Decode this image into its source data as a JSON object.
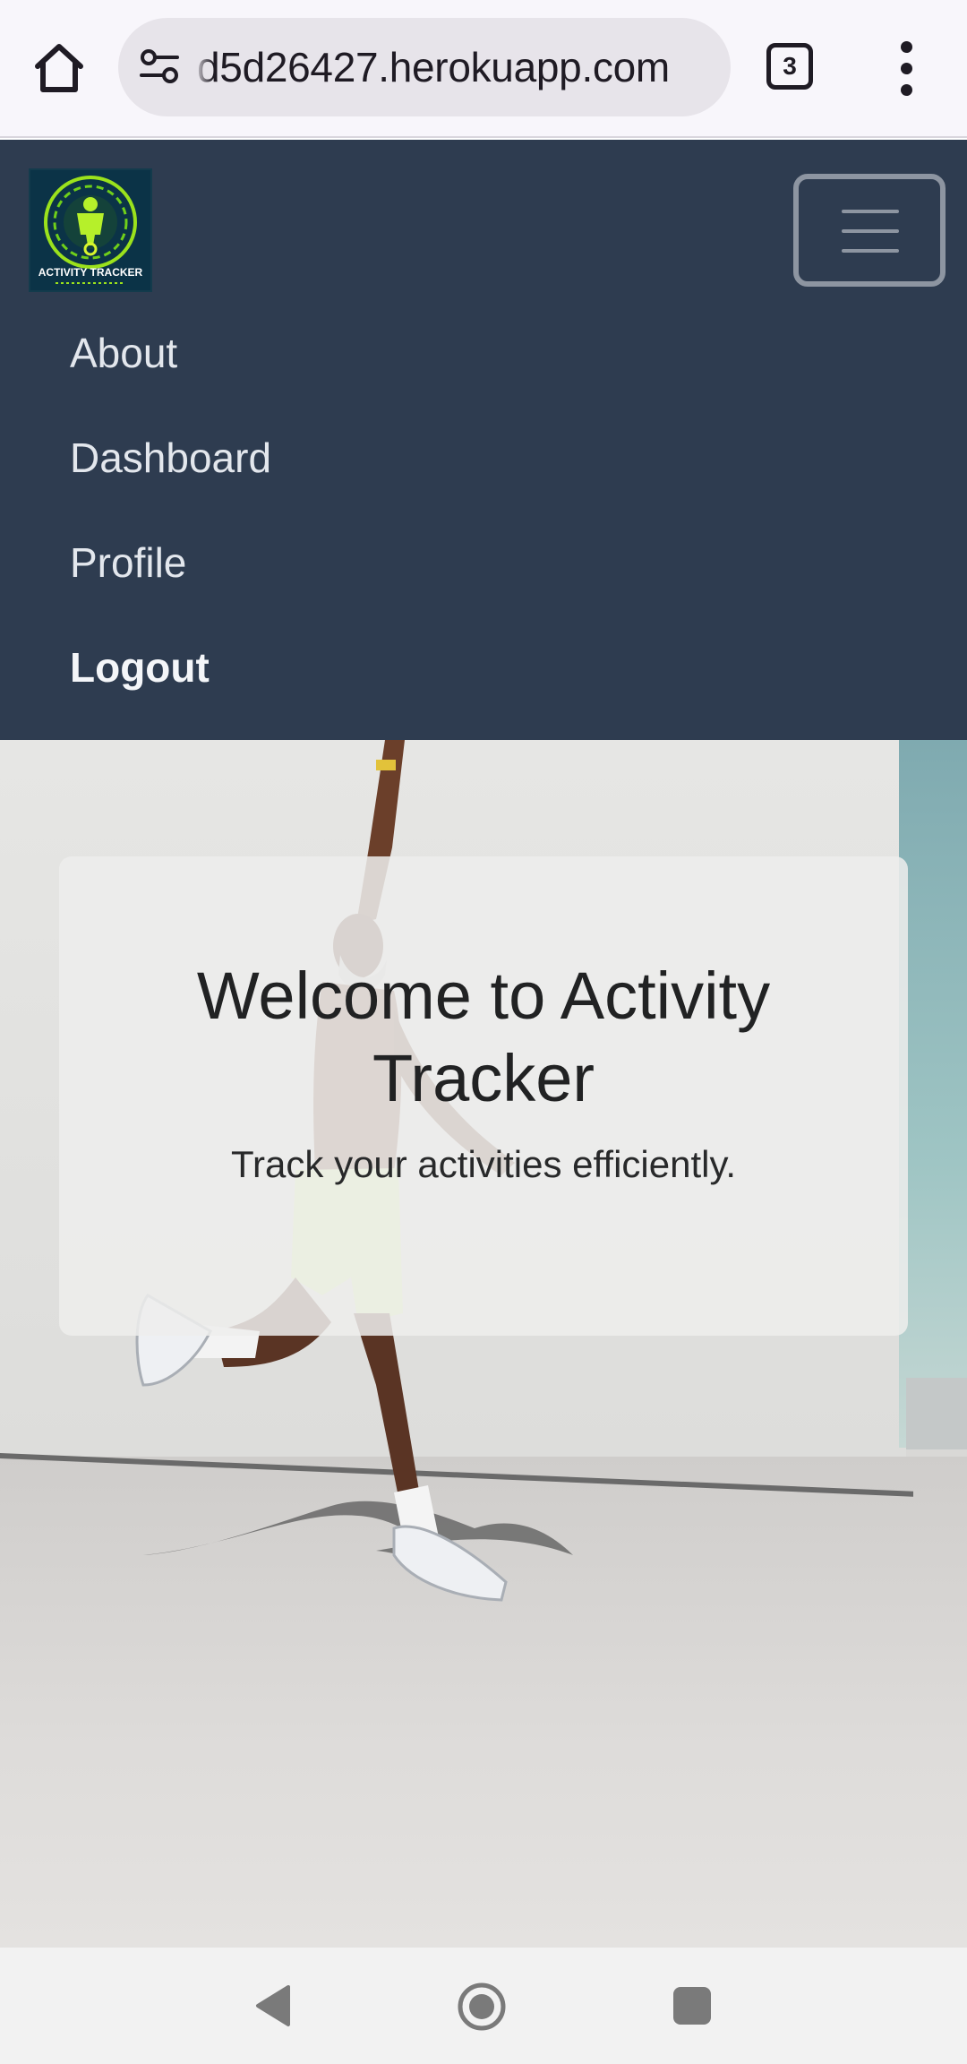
{
  "browser": {
    "url": "d5d26427.herokuapp.com",
    "tab_count": "3",
    "icons": [
      "home-icon",
      "site-info-icon",
      "tab-switcher-icon",
      "more-vert-icon"
    ]
  },
  "navbar": {
    "logo_text": "ACTIVITY TRACKER",
    "items": [
      {
        "label": "About",
        "bold": false
      },
      {
        "label": "Dashboard",
        "bold": false
      },
      {
        "label": "Profile",
        "bold": false
      },
      {
        "label": "Logout",
        "bold": true
      }
    ],
    "background": "#2e3c50"
  },
  "hero": {
    "title": "Welcome to Activity Tracker",
    "subtitle": "Track your activities efficiently."
  },
  "android_nav": {
    "icons": [
      "back-icon",
      "home-circle-icon",
      "recents-icon"
    ]
  }
}
